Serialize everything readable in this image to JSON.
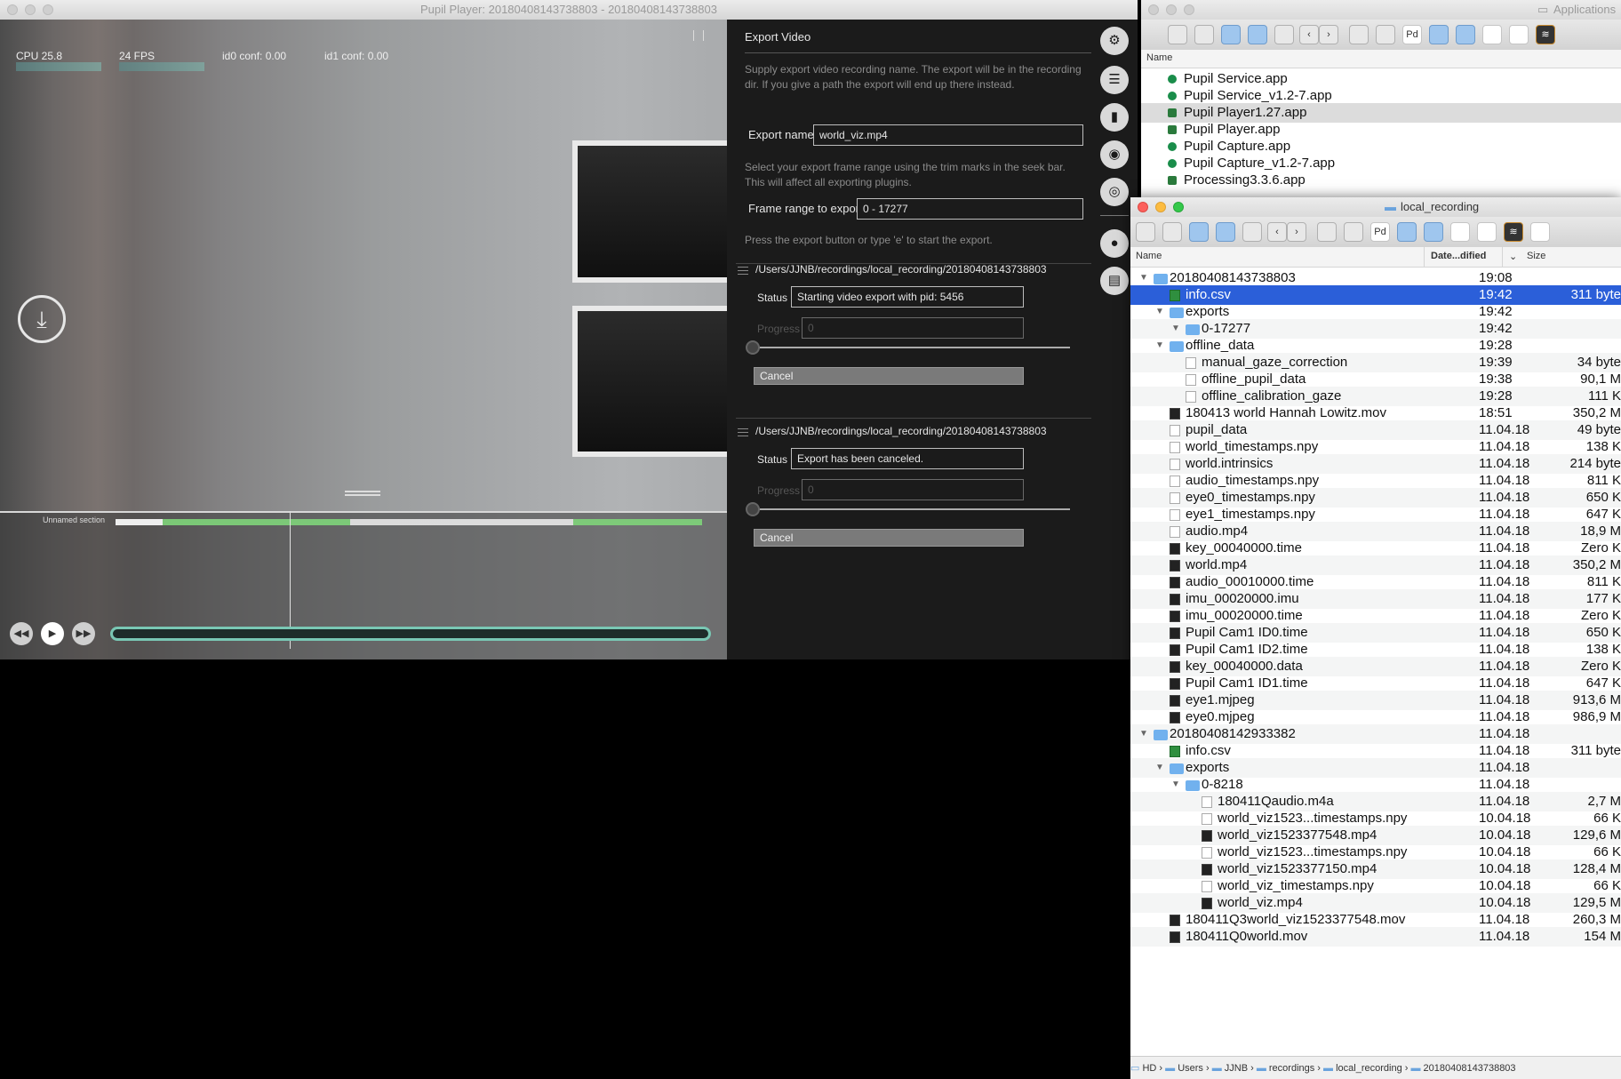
{
  "player": {
    "title": "Pupil Player: 20180408143738803 - 20180408143738803",
    "overlay": {
      "cpu": "CPU 25.8",
      "fps": "24 FPS",
      "id0": "id0 conf: 0.00",
      "id1": "id1 conf: 0.00"
    },
    "timeline": {
      "section_label": "Unnamed section"
    },
    "export_video": {
      "title": "Export Video",
      "help_name": "Supply export video recording name. The export will be in the recording dir. If you give a path the export will end up there instead.",
      "name_label": "Export name",
      "name_value": "world_viz.mp4",
      "help_range": "Select your export frame range using the trim marks in the seek bar. This will affect all exporting plugins.",
      "range_label": "Frame range to export",
      "range_value": "0 - 17277",
      "help_start": "Press the export button or type 'e' to start the export.",
      "tasks": [
        {
          "path": "/Users/JJNB/recordings/local_recording/20180408143738803",
          "status_label": "Status",
          "status_value": "Starting video export with pid: 5456",
          "progress_label": "Progress",
          "progress_value": "0",
          "cancel_label": "Cancel"
        },
        {
          "path": "/Users/JJNB/recordings/local_recording/20180408143738803",
          "status_label": "Status",
          "status_value": "Export has been canceled.",
          "progress_label": "Progress",
          "progress_value": "0",
          "cancel_label": "Cancel"
        }
      ]
    },
    "sidebar_icons": [
      "gear-icon",
      "sliders-icon",
      "bar-chart-icon",
      "eye-icon",
      "target-icon",
      "record-icon",
      "export-icon"
    ]
  },
  "apps_finder": {
    "title": "Applications",
    "column": "Name",
    "items": [
      "Pupil Service.app",
      "Pupil Service_v1.2-7.app",
      "Pupil Player1.27.app",
      "Pupil Player.app",
      "Pupil Capture.app",
      "Pupil Capture_v1.2-7.app",
      "Processing3.3.6.app"
    ]
  },
  "rec_finder": {
    "title": "local_recording",
    "columns": {
      "name": "Name",
      "date": "Date...dified",
      "size": "Size"
    },
    "rows": [
      {
        "name": "20180408143738803",
        "date": "19:08",
        "size": "",
        "level": 0,
        "icon": "folder",
        "disc": "▼"
      },
      {
        "name": "info.csv",
        "date": "19:42",
        "size": "311 byte",
        "level": 1,
        "icon": "csv",
        "selected": true
      },
      {
        "name": "exports",
        "date": "19:42",
        "size": "",
        "level": 1,
        "icon": "folder",
        "disc": "▼"
      },
      {
        "name": "0-17277",
        "date": "19:42",
        "size": "",
        "level": 2,
        "icon": "folder",
        "disc": "▼"
      },
      {
        "name": "offline_data",
        "date": "19:28",
        "size": "",
        "level": 1,
        "icon": "folder",
        "disc": "▼"
      },
      {
        "name": "manual_gaze_correction",
        "date": "19:39",
        "size": "34 byte",
        "level": 2,
        "icon": "doc"
      },
      {
        "name": "offline_pupil_data",
        "date": "19:38",
        "size": "90,1 M",
        "level": 2,
        "icon": "doc"
      },
      {
        "name": "offline_calibration_gaze",
        "date": "19:28",
        "size": "111 K",
        "level": 2,
        "icon": "doc"
      },
      {
        "name": "180413 world Hannah Lowitz.mov",
        "date": "18:51",
        "size": "350,2 M",
        "level": 1,
        "icon": "movie"
      },
      {
        "name": "pupil_data",
        "date": "11.04.18",
        "size": "49 byte",
        "level": 1,
        "icon": "doc"
      },
      {
        "name": "world_timestamps.npy",
        "date": "11.04.18",
        "size": "138 K",
        "level": 1,
        "icon": "doc"
      },
      {
        "name": "world.intrinsics",
        "date": "11.04.18",
        "size": "214 byte",
        "level": 1,
        "icon": "doc"
      },
      {
        "name": "audio_timestamps.npy",
        "date": "11.04.18",
        "size": "811 K",
        "level": 1,
        "icon": "doc"
      },
      {
        "name": "eye0_timestamps.npy",
        "date": "11.04.18",
        "size": "650 K",
        "level": 1,
        "icon": "doc"
      },
      {
        "name": "eye1_timestamps.npy",
        "date": "11.04.18",
        "size": "647 K",
        "level": 1,
        "icon": "doc"
      },
      {
        "name": "audio.mp4",
        "date": "11.04.18",
        "size": "18,9 M",
        "level": 1,
        "icon": "doc"
      },
      {
        "name": "key_00040000.time",
        "date": "11.04.18",
        "size": "Zero K",
        "level": 1,
        "icon": "movie"
      },
      {
        "name": "world.mp4",
        "date": "11.04.18",
        "size": "350,2 M",
        "level": 1,
        "icon": "movie"
      },
      {
        "name": "audio_00010000.time",
        "date": "11.04.18",
        "size": "811 K",
        "level": 1,
        "icon": "movie"
      },
      {
        "name": "imu_00020000.imu",
        "date": "11.04.18",
        "size": "177 K",
        "level": 1,
        "icon": "movie"
      },
      {
        "name": "imu_00020000.time",
        "date": "11.04.18",
        "size": "Zero K",
        "level": 1,
        "icon": "movie"
      },
      {
        "name": "Pupil Cam1 ID0.time",
        "date": "11.04.18",
        "size": "650 K",
        "level": 1,
        "icon": "movie"
      },
      {
        "name": "Pupil Cam1 ID2.time",
        "date": "11.04.18",
        "size": "138 K",
        "level": 1,
        "icon": "movie"
      },
      {
        "name": "key_00040000.data",
        "date": "11.04.18",
        "size": "Zero K",
        "level": 1,
        "icon": "movie"
      },
      {
        "name": "Pupil Cam1 ID1.time",
        "date": "11.04.18",
        "size": "647 K",
        "level": 1,
        "icon": "movie"
      },
      {
        "name": "eye1.mjpeg",
        "date": "11.04.18",
        "size": "913,6 M",
        "level": 1,
        "icon": "movie"
      },
      {
        "name": "eye0.mjpeg",
        "date": "11.04.18",
        "size": "986,9 M",
        "level": 1,
        "icon": "movie"
      },
      {
        "name": "20180408142933382",
        "date": "11.04.18",
        "size": "",
        "level": 0,
        "icon": "folder",
        "disc": "▼"
      },
      {
        "name": "info.csv",
        "date": "11.04.18",
        "size": "311 byte",
        "level": 1,
        "icon": "csv"
      },
      {
        "name": "exports",
        "date": "11.04.18",
        "size": "",
        "level": 1,
        "icon": "folder",
        "disc": "▼"
      },
      {
        "name": "0-8218",
        "date": "11.04.18",
        "size": "",
        "level": 2,
        "icon": "folder",
        "disc": "▼"
      },
      {
        "name": "180411Qaudio.m4a",
        "date": "11.04.18",
        "size": "2,7 M",
        "level": 3,
        "icon": "doc"
      },
      {
        "name": "world_viz1523...timestamps.npy",
        "date": "10.04.18",
        "size": "66 K",
        "level": 3,
        "icon": "doc"
      },
      {
        "name": "world_viz1523377548.mp4",
        "date": "10.04.18",
        "size": "129,6 M",
        "level": 3,
        "icon": "movie"
      },
      {
        "name": "world_viz1523...timestamps.npy",
        "date": "10.04.18",
        "size": "66 K",
        "level": 3,
        "icon": "doc"
      },
      {
        "name": "world_viz1523377150.mp4",
        "date": "10.04.18",
        "size": "128,4 M",
        "level": 3,
        "icon": "movie"
      },
      {
        "name": "world_viz_timestamps.npy",
        "date": "10.04.18",
        "size": "66 K",
        "level": 3,
        "icon": "doc"
      },
      {
        "name": "world_viz.mp4",
        "date": "10.04.18",
        "size": "129,5 M",
        "level": 3,
        "icon": "movie"
      },
      {
        "name": "180411Q3world_viz1523377548.mov",
        "date": "11.04.18",
        "size": "260,3 M",
        "level": 1,
        "icon": "movie"
      },
      {
        "name": "180411Q0world.mov",
        "date": "11.04.18",
        "size": "154 M",
        "level": 1,
        "icon": "movie"
      }
    ],
    "path": [
      "HD",
      "Users",
      "JJNB",
      "recordings",
      "local_recording",
      "20180408143738803"
    ]
  }
}
